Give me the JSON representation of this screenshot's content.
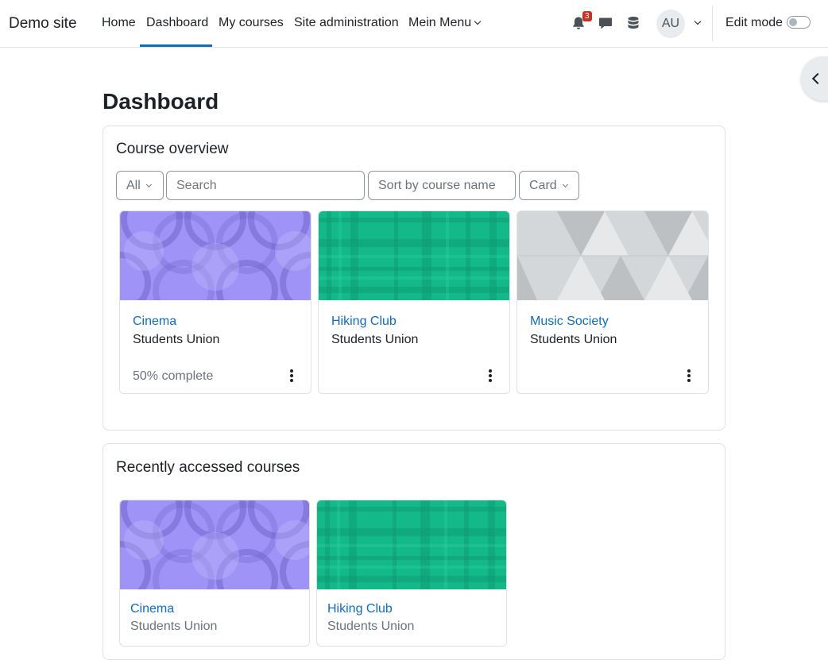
{
  "navbar": {
    "brand": "Demo site",
    "items": [
      {
        "label": "Home"
      },
      {
        "label": "Dashboard"
      },
      {
        "label": "My courses"
      },
      {
        "label": "Site administration"
      },
      {
        "label": "Mein Menu"
      }
    ],
    "notification_count": "3",
    "user_initials": "AU",
    "edit_mode_label": "Edit mode",
    "edit_mode_on": false
  },
  "page_title": "Dashboard",
  "course_overview": {
    "title": "Course overview",
    "filters": {
      "grouping": "All",
      "search_placeholder": "Search",
      "sort": "Sort by course name",
      "view": "Card"
    },
    "courses": [
      {
        "name": "Cinema",
        "category": "Students Union",
        "progress": "50% complete",
        "image": "purple-circles"
      },
      {
        "name": "Hiking Club",
        "category": "Students Union",
        "progress": "",
        "image": "green-plaid"
      },
      {
        "name": "Music Society",
        "category": "Students Union",
        "progress": "",
        "image": "grey-triangles"
      }
    ]
  },
  "recent_courses": {
    "title": "Recently accessed courses",
    "courses": [
      {
        "name": "Cinema",
        "category": "Students Union",
        "image": "purple-circles"
      },
      {
        "name": "Hiking Club",
        "category": "Students Union",
        "image": "green-plaid"
      }
    ]
  },
  "colors": {
    "link": "#0f6cbf",
    "active_tab": "#0f6cbf",
    "badge": "#ca3120",
    "cinema_bg": "#9f93f7",
    "hiking_bg": "#14b989",
    "music_bg": "#d4d7d9"
  },
  "icons": [
    "bell-icon",
    "chat-icon",
    "database-icon",
    "chevron-down-icon",
    "chevron-left-icon",
    "more-vertical-icon"
  ]
}
